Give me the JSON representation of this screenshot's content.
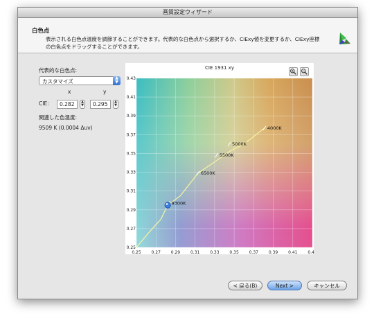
{
  "window": {
    "title": "画質設定ウィザード"
  },
  "header": {
    "title": "白色点",
    "description": "表示される白色点温度を調節することができます。代表的な白色点から選択するか、CIExy値を変更するか、CIExy座標の白色点をドラッグすることができます。",
    "logo_icon": "cie-triangle-icon"
  },
  "left": {
    "preset_label": "代表的な白色点:",
    "preset_value": "カスタマイズ",
    "x_label": "x",
    "y_label": "y",
    "cie_label": "CIE:",
    "x_value": "0.282",
    "y_value": "0.295",
    "related_label": "関連した色温度:",
    "related_value": "9509 K (0.0004 Δuv)"
  },
  "chart_data": {
    "type": "scatter",
    "title": "CIE 1931 xy",
    "xlim": [
      0.25,
      0.43
    ],
    "ylim": [
      0.25,
      0.43
    ],
    "x_ticks": [
      "0.25",
      "0.27",
      "0.29",
      "0.31",
      "0.33",
      "0.35",
      "0.37",
      "0.39",
      "0.41",
      "0.43"
    ],
    "y_ticks": [
      "0.25",
      "0.27",
      "0.29",
      "0.31",
      "0.33",
      "0.35",
      "0.37",
      "0.39",
      "0.41",
      "0.43"
    ],
    "grid": true,
    "locus": [
      [
        0.25,
        0.25
      ],
      [
        0.262,
        0.265
      ],
      [
        0.275,
        0.28
      ],
      [
        0.282,
        0.295
      ],
      [
        0.295,
        0.305
      ],
      [
        0.313,
        0.329
      ],
      [
        0.33,
        0.341
      ],
      [
        0.345,
        0.352
      ],
      [
        0.36,
        0.36
      ],
      [
        0.381,
        0.377
      ]
    ],
    "points": [
      {
        "label": "9300K",
        "x": 0.283,
        "y": 0.297
      },
      {
        "label": "6500K",
        "x": 0.313,
        "y": 0.329
      },
      {
        "label": "5500K",
        "x": 0.332,
        "y": 0.348
      },
      {
        "label": "5000K",
        "x": 0.345,
        "y": 0.36
      },
      {
        "label": "4000K",
        "x": 0.381,
        "y": 0.377
      }
    ],
    "current": {
      "x": 0.282,
      "y": 0.295
    }
  },
  "buttons": {
    "back": "< 戻る(B)",
    "next": "Next >",
    "cancel": "キャンセル"
  },
  "zoom_in_icon": "zoom-in-icon",
  "zoom_out_icon": "zoom-out-icon"
}
